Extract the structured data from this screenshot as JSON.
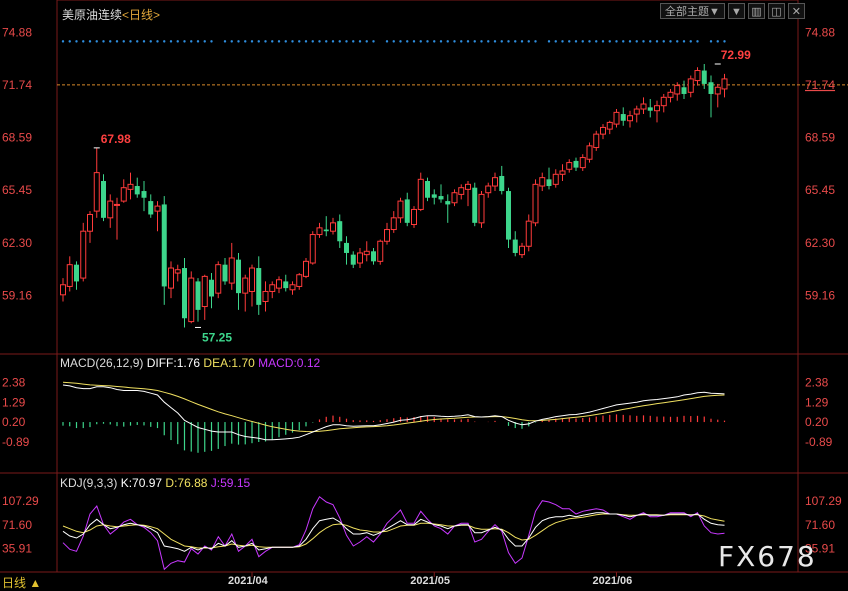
{
  "header": {
    "title": "美原油连续",
    "period": "<日线>",
    "menu_label": "全部主题▼"
  },
  "toolbar_icons": [
    "down-triangle-icon",
    "chart-icon",
    "restore-icon",
    "close-icon"
  ],
  "period_button": "日线 ▲",
  "watermark": "FX678",
  "colors": {
    "up": "#ff3b3b",
    "down": "#3dd68c",
    "diff": "#ffffff",
    "dea": "#f0e060",
    "macd": "#c838ff",
    "k": "#ffffff",
    "d": "#f0e060",
    "j": "#c838ff",
    "axis_text": "#e84a4a"
  },
  "chart_data": [
    {
      "type": "candlestick",
      "name": "price",
      "yticks": [
        74.88,
        71.74,
        68.59,
        65.45,
        62.3,
        59.16
      ],
      "ytick_labels": [
        "74.88",
        "71.74",
        "68.59",
        "65.45",
        "62.30",
        "59.16"
      ],
      "ylim": [
        56.5,
        75.5
      ],
      "last_price_line": 71.74,
      "x_labels": [
        {
          "index": 28,
          "label": "2021/04"
        },
        {
          "index": 55,
          "label": "2021/05"
        },
        {
          "index": 82,
          "label": "2021/06"
        }
      ],
      "annotations": [
        {
          "index": 5,
          "value": 67.98,
          "label": "67.98",
          "position": "above"
        },
        {
          "index": 20,
          "value": 57.25,
          "label": "57.25",
          "position": "below"
        },
        {
          "index": 97,
          "value": 72.99,
          "label": "72.99",
          "position": "above"
        }
      ],
      "ohlc": [
        [
          59.2,
          60.2,
          58.8,
          59.8
        ],
        [
          59.7,
          61.5,
          59.4,
          61.0
        ],
        [
          61.0,
          61.2,
          59.5,
          60.0
        ],
        [
          60.2,
          63.5,
          60.0,
          63.0
        ],
        [
          63.0,
          64.2,
          62.3,
          64.0
        ],
        [
          64.2,
          67.98,
          63.8,
          66.5
        ],
        [
          66.0,
          66.4,
          63.6,
          63.8
        ],
        [
          63.8,
          65.2,
          63.2,
          64.8
        ],
        [
          64.6,
          65.0,
          62.5,
          64.6
        ],
        [
          64.8,
          66.1,
          64.7,
          65.6
        ],
        [
          65.5,
          66.5,
          64.9,
          65.8
        ],
        [
          65.7,
          66.2,
          65.0,
          65.2
        ],
        [
          65.4,
          66.0,
          64.2,
          65.0
        ],
        [
          64.8,
          65.2,
          63.8,
          64.0
        ],
        [
          64.2,
          64.8,
          63.0,
          64.5
        ],
        [
          64.6,
          65.1,
          58.6,
          59.7
        ],
        [
          59.6,
          61.2,
          59.0,
          60.8
        ],
        [
          60.5,
          61.0,
          60.0,
          60.7
        ],
        [
          60.8,
          61.4,
          57.25,
          57.8
        ],
        [
          57.6,
          60.6,
          57.5,
          60.2
        ],
        [
          60.0,
          60.2,
          57.6,
          58.3
        ],
        [
          58.5,
          60.4,
          57.7,
          60.3
        ],
        [
          60.1,
          60.5,
          58.4,
          59.1
        ],
        [
          59.3,
          61.2,
          59.0,
          61.0
        ],
        [
          61.0,
          61.4,
          59.8,
          60.0
        ],
        [
          59.9,
          62.3,
          59.5,
          61.4
        ],
        [
          61.3,
          61.7,
          58.3,
          59.3
        ],
        [
          59.3,
          60.4,
          58.2,
          60.2
        ],
        [
          59.4,
          61.0,
          58.5,
          60.8
        ],
        [
          60.8,
          61.5,
          58.0,
          58.6
        ],
        [
          58.8,
          60.0,
          58.2,
          59.4
        ],
        [
          59.4,
          60.0,
          59.0,
          59.8
        ],
        [
          59.6,
          60.3,
          59.3,
          60.1
        ],
        [
          60.0,
          60.4,
          59.4,
          59.6
        ],
        [
          59.5,
          60.0,
          59.2,
          59.8
        ],
        [
          59.7,
          60.5,
          59.5,
          60.4
        ],
        [
          60.3,
          61.4,
          60.2,
          61.2
        ],
        [
          61.1,
          63.0,
          61.0,
          62.8
        ],
        [
          62.8,
          63.5,
          62.6,
          63.2
        ],
        [
          63.1,
          63.9,
          62.7,
          63.0
        ],
        [
          63.0,
          63.8,
          62.8,
          63.5
        ],
        [
          63.6,
          64.0,
          62.0,
          62.4
        ],
        [
          62.3,
          62.7,
          61.0,
          61.7
        ],
        [
          61.6,
          61.8,
          60.8,
          61.0
        ],
        [
          61.1,
          62.0,
          60.8,
          61.7
        ],
        [
          61.6,
          62.4,
          61.2,
          61.8
        ],
        [
          61.8,
          62.0,
          61.0,
          61.2
        ],
        [
          61.2,
          62.5,
          61.0,
          62.4
        ],
        [
          62.4,
          63.5,
          62.2,
          63.1
        ],
        [
          63.1,
          64.2,
          62.9,
          63.8
        ],
        [
          63.8,
          65.0,
          63.5,
          64.8
        ],
        [
          64.9,
          65.3,
          63.3,
          63.5
        ],
        [
          63.4,
          64.5,
          63.2,
          64.3
        ],
        [
          64.3,
          66.5,
          64.2,
          66.1
        ],
        [
          66.0,
          66.2,
          64.8,
          65.0
        ],
        [
          65.2,
          65.5,
          64.6,
          65.0
        ],
        [
          65.1,
          65.8,
          64.7,
          64.9
        ],
        [
          64.8,
          65.2,
          63.5,
          64.6
        ],
        [
          64.7,
          65.5,
          64.5,
          65.3
        ],
        [
          65.2,
          65.8,
          64.9,
          65.6
        ],
        [
          65.5,
          66.0,
          64.5,
          65.8
        ],
        [
          65.6,
          65.9,
          63.3,
          63.5
        ],
        [
          63.5,
          65.4,
          63.2,
          65.2
        ],
        [
          65.3,
          65.9,
          65.0,
          65.7
        ],
        [
          65.7,
          66.5,
          65.4,
          66.2
        ],
        [
          66.3,
          66.9,
          65.2,
          65.4
        ],
        [
          65.4,
          65.6,
          62.0,
          62.5
        ],
        [
          62.5,
          63.0,
          61.5,
          61.7
        ],
        [
          61.6,
          62.3,
          61.4,
          62.1
        ],
        [
          62.1,
          64.0,
          61.8,
          63.6
        ],
        [
          63.5,
          66.1,
          63.3,
          65.8
        ],
        [
          65.7,
          66.5,
          65.4,
          66.2
        ],
        [
          66.1,
          66.8,
          65.5,
          65.7
        ],
        [
          65.8,
          66.7,
          65.6,
          66.4
        ],
        [
          66.4,
          67.0,
          66.0,
          66.6
        ],
        [
          66.7,
          67.3,
          66.5,
          67.1
        ],
        [
          67.2,
          67.4,
          66.6,
          66.8
        ],
        [
          66.8,
          67.6,
          66.6,
          67.4
        ],
        [
          67.3,
          68.3,
          67.1,
          68.1
        ],
        [
          68.0,
          69.0,
          67.8,
          68.8
        ],
        [
          68.8,
          69.4,
          68.5,
          69.2
        ],
        [
          69.1,
          69.6,
          68.8,
          69.5
        ],
        [
          69.4,
          70.3,
          69.2,
          70.1
        ],
        [
          70.0,
          70.4,
          69.3,
          69.6
        ],
        [
          69.6,
          70.2,
          69.2,
          69.9
        ],
        [
          70.0,
          70.5,
          69.5,
          70.3
        ],
        [
          70.3,
          71.0,
          70.0,
          70.6
        ],
        [
          70.4,
          70.9,
          69.8,
          70.2
        ],
        [
          70.2,
          70.8,
          69.5,
          70.5
        ],
        [
          70.5,
          71.2,
          70.1,
          71.0
        ],
        [
          71.0,
          71.5,
          70.7,
          71.3
        ],
        [
          71.2,
          71.9,
          70.8,
          71.7
        ],
        [
          71.6,
          72.0,
          70.9,
          71.2
        ],
        [
          71.3,
          72.3,
          71.0,
          72.1
        ],
        [
          72.0,
          72.8,
          71.7,
          72.6
        ],
        [
          72.6,
          72.99,
          71.5,
          71.8
        ],
        [
          71.9,
          72.3,
          69.8,
          71.2
        ],
        [
          71.2,
          71.8,
          70.4,
          71.6
        ],
        [
          71.5,
          72.4,
          71.0,
          72.1
        ]
      ]
    },
    {
      "type": "line+bar",
      "name": "MACD",
      "legend": {
        "label": "MACD(26,12,9)",
        "diff": "DIFF:1.76",
        "dea": "DEA:1.70",
        "macd": "MACD:0.12"
      },
      "yticks": [
        2.38,
        1.29,
        0.2,
        -0.89
      ],
      "ytick_labels": [
        "2.38",
        "1.29",
        "0.20",
        "-0.89"
      ],
      "ylim": [
        -1.9,
        2.75
      ],
      "diff": [
        2.25,
        2.2,
        2.1,
        2.05,
        2.05,
        2.15,
        2.15,
        2.1,
        2.0,
        1.95,
        1.95,
        1.95,
        1.9,
        1.8,
        1.7,
        1.3,
        1.0,
        0.7,
        0.3,
        0.1,
        -0.1,
        -0.2,
        -0.3,
        -0.35,
        -0.35,
        -0.35,
        -0.5,
        -0.6,
        -0.65,
        -0.7,
        -0.78,
        -0.78,
        -0.76,
        -0.73,
        -0.7,
        -0.64,
        -0.5,
        -0.35,
        -0.2,
        -0.05,
        0.05,
        0.05,
        0.0,
        -0.03,
        -0.02,
        0.0,
        0.0,
        0.05,
        0.12,
        0.2,
        0.3,
        0.33,
        0.4,
        0.5,
        0.55,
        0.55,
        0.52,
        0.5,
        0.52,
        0.55,
        0.6,
        0.5,
        0.48,
        0.5,
        0.55,
        0.5,
        0.3,
        0.15,
        0.05,
        0.1,
        0.25,
        0.35,
        0.42,
        0.5,
        0.55,
        0.6,
        0.62,
        0.68,
        0.75,
        0.85,
        0.95,
        1.05,
        1.15,
        1.2,
        1.25,
        1.3,
        1.38,
        1.42,
        1.45,
        1.5,
        1.55,
        1.6,
        1.7,
        1.75,
        1.82,
        1.85,
        1.8,
        1.78,
        1.76
      ],
      "dea": [
        2.4,
        2.38,
        2.35,
        2.3,
        2.26,
        2.24,
        2.22,
        2.2,
        2.17,
        2.14,
        2.1,
        2.07,
        2.04,
        2.0,
        1.95,
        1.85,
        1.75,
        1.62,
        1.48,
        1.33,
        1.18,
        1.04,
        0.9,
        0.77,
        0.65,
        0.55,
        0.44,
        0.33,
        0.23,
        0.13,
        0.03,
        -0.06,
        -0.13,
        -0.2,
        -0.26,
        -0.3,
        -0.32,
        -0.33,
        -0.31,
        -0.27,
        -0.22,
        -0.17,
        -0.14,
        -0.11,
        -0.09,
        -0.07,
        -0.05,
        -0.03,
        0.0,
        0.04,
        0.09,
        0.14,
        0.19,
        0.25,
        0.3,
        0.34,
        0.37,
        0.39,
        0.41,
        0.44,
        0.47,
        0.48,
        0.48,
        0.49,
        0.5,
        0.5,
        0.46,
        0.4,
        0.33,
        0.28,
        0.27,
        0.29,
        0.32,
        0.35,
        0.39,
        0.43,
        0.47,
        0.51,
        0.56,
        0.62,
        0.68,
        0.75,
        0.83,
        0.9,
        0.97,
        1.04,
        1.1,
        1.16,
        1.22,
        1.27,
        1.33,
        1.38,
        1.44,
        1.5,
        1.56,
        1.62,
        1.66,
        1.68,
        1.7
      ],
      "macd_hist": [
        -0.3,
        -0.35,
        -0.5,
        -0.5,
        -0.42,
        -0.18,
        -0.14,
        -0.2,
        -0.34,
        -0.38,
        -0.3,
        -0.24,
        -0.28,
        -0.4,
        -0.5,
        -1.1,
        -1.5,
        -1.84,
        -2.36,
        -2.46,
        -2.56,
        -2.48,
        -2.4,
        -2.24,
        -2.0,
        -1.8,
        -1.88,
        -1.86,
        -1.76,
        -1.66,
        -1.62,
        -1.44,
        -1.26,
        -1.06,
        -0.88,
        -0.68,
        -0.36,
        -0.04,
        0.22,
        0.44,
        0.54,
        0.44,
        0.28,
        0.16,
        0.14,
        0.14,
        0.1,
        0.16,
        0.24,
        0.32,
        0.42,
        0.38,
        0.42,
        0.5,
        0.5,
        0.42,
        0.3,
        0.22,
        0.22,
        0.22,
        0.26,
        0.04,
        0.0,
        0.02,
        0.1,
        0.0,
        -0.32,
        -0.5,
        -0.56,
        -0.36,
        -0.04,
        0.12,
        0.2,
        0.3,
        0.32,
        0.34,
        0.3,
        0.34,
        0.38,
        0.46,
        0.54,
        0.6,
        0.64,
        0.6,
        0.56,
        0.52,
        0.56,
        0.52,
        0.46,
        0.46,
        0.44,
        0.44,
        0.52,
        0.5,
        0.52,
        0.46,
        0.28,
        0.2,
        0.12
      ]
    },
    {
      "type": "line",
      "name": "KDJ",
      "legend": {
        "label": "KDJ(9,3,3)",
        "k": "K:70.97",
        "d": "D:76.88",
        "j": "J:59.15"
      },
      "yticks": [
        107.29,
        71.6,
        35.91
      ],
      "ytick_labels": [
        "107.29",
        "71.60",
        "35.91"
      ],
      "ylim": [
        10,
        118
      ],
      "k": [
        62,
        55,
        52,
        58,
        72,
        80,
        72,
        66,
        68,
        72,
        74,
        72,
        70,
        66,
        60,
        40,
        38,
        36,
        32,
        38,
        34,
        38,
        36,
        44,
        40,
        48,
        38,
        40,
        44,
        34,
        36,
        38,
        38,
        38,
        38,
        40,
        50,
        66,
        78,
        80,
        82,
        76,
        66,
        58,
        58,
        60,
        56,
        60,
        66,
        72,
        78,
        72,
        72,
        80,
        76,
        72,
        70,
        66,
        70,
        72,
        72,
        60,
        60,
        64,
        68,
        64,
        50,
        40,
        40,
        52,
        68,
        78,
        82,
        84,
        84,
        86,
        84,
        86,
        88,
        90,
        90,
        88,
        88,
        86,
        84,
        86,
        88,
        86,
        86,
        86,
        88,
        88,
        88,
        86,
        88,
        80,
        74,
        72,
        71
      ],
      "d": [
        70,
        66,
        62,
        60,
        64,
        70,
        72,
        70,
        69,
        70,
        71,
        72,
        71,
        69,
        66,
        58,
        50,
        45,
        40,
        39,
        37,
        37,
        37,
        39,
        40,
        43,
        41,
        40,
        41,
        39,
        38,
        38,
        38,
        38,
        38,
        39,
        43,
        51,
        60,
        67,
        72,
        73,
        71,
        67,
        64,
        63,
        61,
        61,
        62,
        66,
        70,
        71,
        71,
        74,
        74,
        73,
        72,
        70,
        70,
        71,
        71,
        67,
        65,
        65,
        66,
        65,
        60,
        53,
        49,
        50,
        56,
        63,
        70,
        75,
        78,
        81,
        82,
        83,
        85,
        87,
        88,
        88,
        88,
        87,
        86,
        86,
        87,
        87,
        87,
        86,
        87,
        87,
        87,
        87,
        87,
        85,
        81,
        79,
        77
      ],
      "j": [
        45,
        35,
        32,
        55,
        88,
        100,
        72,
        58,
        66,
        76,
        80,
        72,
        68,
        60,
        48,
        5,
        14,
        18,
        16,
        36,
        28,
        40,
        34,
        54,
        40,
        58,
        32,
        40,
        50,
        24,
        32,
        38,
        38,
        38,
        38,
        42,
        64,
        96,
        114,
        106,
        102,
        82,
        56,
        40,
        46,
        54,
        46,
        58,
        74,
        84,
        94,
        74,
        74,
        92,
        80,
        70,
        66,
        58,
        70,
        74,
        74,
        46,
        50,
        62,
        72,
        62,
        30,
        14,
        22,
        56,
        92,
        108,
        106,
        102,
        96,
        96,
        88,
        92,
        94,
        96,
        94,
        88,
        88,
        84,
        80,
        86,
        90,
        84,
        84,
        86,
        90,
        90,
        90,
        84,
        90,
        70,
        60,
        58,
        59
      ]
    }
  ]
}
